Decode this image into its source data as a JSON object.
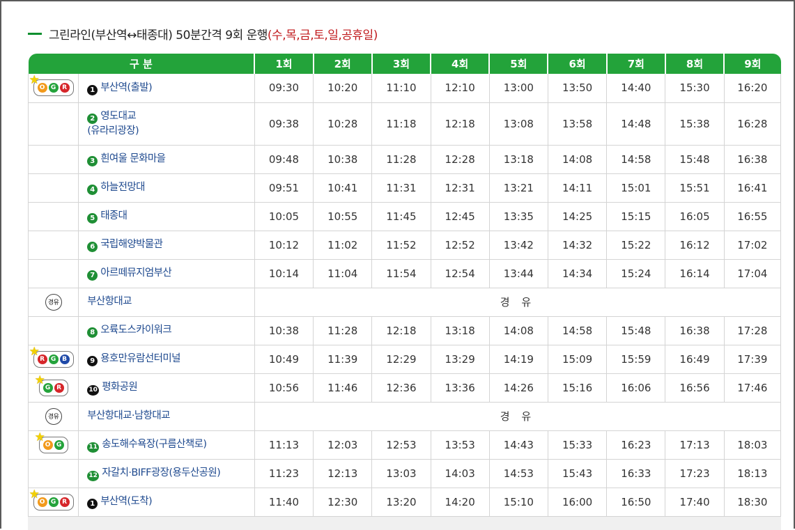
{
  "title": {
    "main": "그린라인(부산역↔태종대) 50분간격 9회 운행",
    "days": "(수,목,금,토,일,공휴일)"
  },
  "colors": {
    "header_green": "#23a33a",
    "stop_blue": "#1f4a8f",
    "days_red": "#c0191c",
    "orange": "#f29a1c",
    "green": "#24a33b",
    "red": "#d6262a",
    "blue": "#1f4aa8"
  },
  "table": {
    "headers": [
      "구 분",
      "1회",
      "2회",
      "3회",
      "4회",
      "5회",
      "6회",
      "7회",
      "8회",
      "9회"
    ],
    "rows": [
      {
        "badge": [
          "O",
          "G",
          "R"
        ],
        "num": "1",
        "stop": "부산역(출발)",
        "times": [
          "09:30",
          "10:20",
          "11:10",
          "12:10",
          "13:00",
          "13:50",
          "14:40",
          "15:30",
          "16:20"
        ]
      },
      {
        "num": "2",
        "stop": "영도대교",
        "stop2": "(유라리광장)",
        "times": [
          "09:38",
          "10:28",
          "11:18",
          "12:18",
          "13:08",
          "13:58",
          "14:48",
          "15:38",
          "16:28"
        ]
      },
      {
        "num": "3",
        "stop": "흰여울 문화마을",
        "times": [
          "09:48",
          "10:38",
          "11:28",
          "12:28",
          "13:18",
          "14:08",
          "14:58",
          "15:48",
          "16:38"
        ]
      },
      {
        "num": "4",
        "stop": "하늘전망대",
        "times": [
          "09:51",
          "10:41",
          "11:31",
          "12:31",
          "13:21",
          "14:11",
          "15:01",
          "15:51",
          "16:41"
        ]
      },
      {
        "num": "5",
        "stop": "태종대",
        "times": [
          "10:05",
          "10:55",
          "11:45",
          "12:45",
          "13:35",
          "14:25",
          "15:15",
          "16:05",
          "16:55"
        ]
      },
      {
        "num": "6",
        "stop": "국립해양박물관",
        "times": [
          "10:12",
          "11:02",
          "11:52",
          "12:52",
          "13:42",
          "14:32",
          "15:22",
          "16:12",
          "17:02"
        ]
      },
      {
        "num": "7",
        "stop": "아르떼뮤지엄부산",
        "times": [
          "10:14",
          "11:04",
          "11:54",
          "12:54",
          "13:44",
          "14:34",
          "15:24",
          "16:14",
          "17:04"
        ]
      },
      {
        "via_icon": "경유",
        "stop": "부산항대교",
        "via_text": "경 유"
      },
      {
        "num": "8",
        "stop": "오륙도스카이워크",
        "times": [
          "10:38",
          "11:28",
          "12:18",
          "13:18",
          "14:08",
          "14:58",
          "15:48",
          "16:38",
          "17:28"
        ]
      },
      {
        "badge": [
          "R",
          "G",
          "B"
        ],
        "num": "9",
        "stop": "용호만유람선터미널",
        "times": [
          "10:49",
          "11:39",
          "12:29",
          "13:29",
          "14:19",
          "15:09",
          "15:59",
          "16:49",
          "17:39"
        ]
      },
      {
        "badge": [
          "G",
          "R"
        ],
        "num": "10",
        "stop": "평화공원",
        "times": [
          "10:56",
          "11:46",
          "12:36",
          "13:36",
          "14:26",
          "15:16",
          "16:06",
          "16:56",
          "17:46"
        ]
      },
      {
        "via_icon": "경유",
        "stop": "부산항대교·남항대교",
        "via_text": "경 유"
      },
      {
        "badge": [
          "O",
          "G"
        ],
        "num": "11",
        "stop": "송도해수욕장(구름산책로)",
        "times": [
          "11:13",
          "12:03",
          "12:53",
          "13:53",
          "14:43",
          "15:33",
          "16:23",
          "17:13",
          "18:03"
        ]
      },
      {
        "num": "12",
        "stop": "자갈치·BIFF광장(용두산공원)",
        "times": [
          "11:23",
          "12:13",
          "13:03",
          "14:03",
          "14:53",
          "15:43",
          "16:33",
          "17:23",
          "18:13"
        ]
      },
      {
        "badge": [
          "O",
          "G",
          "R"
        ],
        "num": "1",
        "stop": "부산역(도착)",
        "times": [
          "11:40",
          "12:30",
          "13:20",
          "14:20",
          "15:10",
          "16:00",
          "16:50",
          "17:40",
          "18:30"
        ]
      }
    ]
  }
}
